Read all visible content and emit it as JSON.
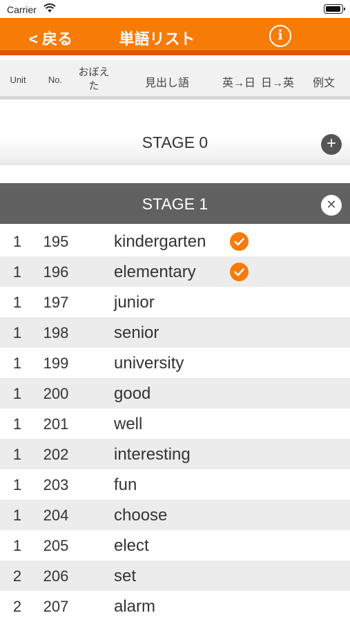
{
  "status_bar": {
    "carrier": "Carrier"
  },
  "nav": {
    "back_label": "< 戻る",
    "title": "単語リスト",
    "info_icon": "i"
  },
  "columns": {
    "unit": "Unit",
    "no": "No.",
    "oboeta_line1": "おぼえ",
    "oboeta_line2": "た",
    "midashi": "見出し語",
    "en2ja": "英→日",
    "ja2en": "日→英",
    "example": "例文"
  },
  "stage0": {
    "label": "STAGE 0",
    "action_icon": "plus-icon"
  },
  "stage1": {
    "label": "STAGE 1",
    "action_icon": "close-icon"
  },
  "words": [
    {
      "unit": "1",
      "no": "195",
      "word": "kindergarten",
      "learned": true
    },
    {
      "unit": "1",
      "no": "196",
      "word": "elementary",
      "learned": true
    },
    {
      "unit": "1",
      "no": "197",
      "word": "junior",
      "learned": false
    },
    {
      "unit": "1",
      "no": "198",
      "word": "senior",
      "learned": false
    },
    {
      "unit": "1",
      "no": "199",
      "word": "university",
      "learned": false
    },
    {
      "unit": "1",
      "no": "200",
      "word": "good",
      "learned": false
    },
    {
      "unit": "1",
      "no": "201",
      "word": "well",
      "learned": false
    },
    {
      "unit": "1",
      "no": "202",
      "word": "interesting",
      "learned": false
    },
    {
      "unit": "1",
      "no": "203",
      "word": "fun",
      "learned": false
    },
    {
      "unit": "1",
      "no": "204",
      "word": "choose",
      "learned": false
    },
    {
      "unit": "1",
      "no": "205",
      "word": "elect",
      "learned": false
    },
    {
      "unit": "2",
      "no": "206",
      "word": "set",
      "learned": false
    },
    {
      "unit": "2",
      "no": "207",
      "word": "alarm",
      "learned": false
    }
  ],
  "colors": {
    "accent": "#f77b07",
    "accent_dark": "#e5520a",
    "stage_bar": "#616161"
  }
}
